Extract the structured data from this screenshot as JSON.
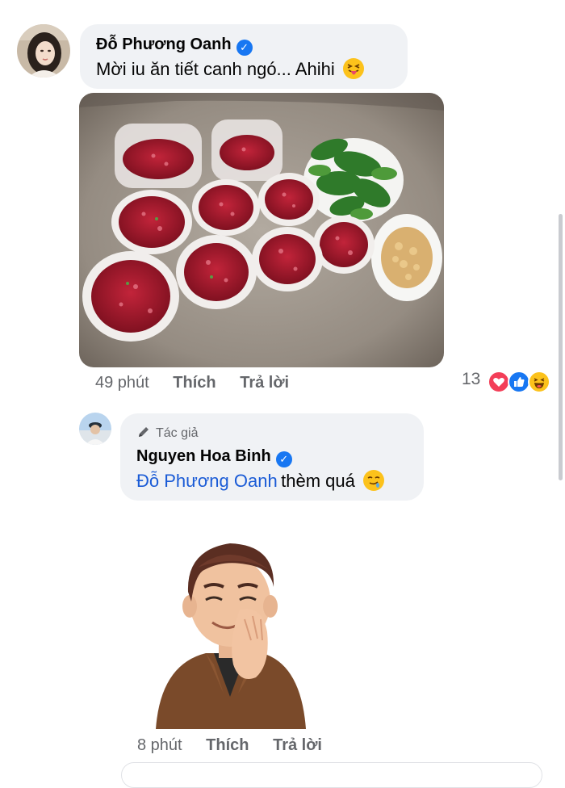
{
  "comment1": {
    "author": "Đỗ Phương Oanh",
    "text": "Mời iu ăn tiết canh ngó... Ahihi",
    "emoji": "squinting-tongue-emoji",
    "photo_icon": "food-photo",
    "time": "49 phút",
    "like_label": "Thích",
    "reply_label": "Trả lời",
    "reaction_count": "13",
    "reactions": [
      "love-reaction-icon",
      "like-reaction-icon",
      "haha-reaction-icon"
    ]
  },
  "reply1": {
    "badge_label": "Tác giả",
    "author": "Nguyen Hoa Binh",
    "mention": "Đỗ Phương Oanh",
    "text": "thèm quá",
    "emoji": "drooling-face-emoji",
    "sticker_icon": "avatar-sticker",
    "time": "8 phút",
    "like_label": "Thích",
    "reply_label": "Trả lời"
  },
  "colors": {
    "bubble": "#f0f2f5",
    "verified": "#1877f2",
    "mention": "#1a5bd6",
    "meta": "#65676b"
  }
}
